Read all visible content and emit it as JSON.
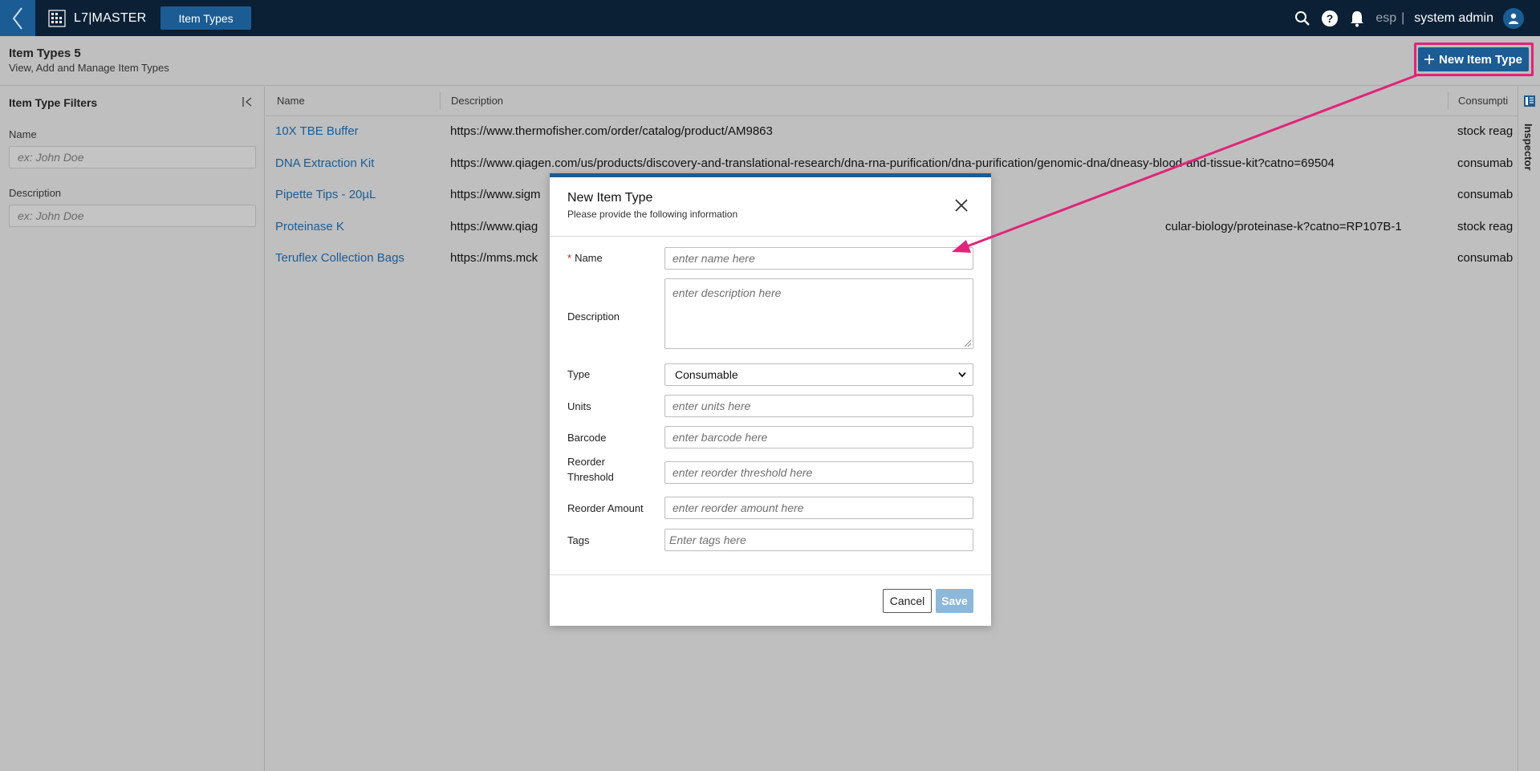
{
  "header": {
    "app_name": "L7|MASTER",
    "nav_tab": "Item Types",
    "language": "esp",
    "separator": "|",
    "user_name": "system admin"
  },
  "page": {
    "title": "Item Types 5",
    "subtitle": "View, Add and Manage Item Types",
    "new_button_label": "New Item Type"
  },
  "filters": {
    "title": "Item Type Filters",
    "name_label": "Name",
    "name_placeholder": "ex: John Doe",
    "description_label": "Description",
    "description_placeholder": "ex: John Doe"
  },
  "table": {
    "columns": [
      "Name",
      "Description",
      "Consumpti"
    ],
    "rows": [
      {
        "name": "10X TBE Buffer",
        "description": "https://www.thermofisher.com/order/catalog/product/AM9863",
        "consumption": "stock reag"
      },
      {
        "name": "DNA Extraction Kit",
        "description": "https://www.qiagen.com/us/products/discovery-and-translational-research/dna-rna-purification/dna-purification/genomic-dna/dneasy-blood-and-tissue-kit?catno=69504",
        "consumption": "consumab"
      },
      {
        "name": "Pipette Tips - 20µL",
        "description": "https://www.sigm",
        "consumption": "consumab"
      },
      {
        "name": "Proteinase K",
        "description": "https://www.qiag",
        "description_tail": "cular-biology/proteinase-k?catno=RP107B-1",
        "consumption": "stock reag"
      },
      {
        "name": "Teruflex Collection Bags",
        "description": "https://mms.mck",
        "consumption": "consumab"
      }
    ]
  },
  "inspector": {
    "label": "Inspector"
  },
  "modal": {
    "title": "New Item Type",
    "subtitle": "Please provide the following information",
    "required_marker": "*",
    "fields": {
      "name": {
        "label": "Name",
        "placeholder": "enter name here"
      },
      "description": {
        "label": "Description",
        "placeholder": "enter description here"
      },
      "type": {
        "label": "Type",
        "value": "Consumable"
      },
      "units": {
        "label": "Units",
        "placeholder": "enter units here"
      },
      "barcode": {
        "label": "Barcode",
        "placeholder": "enter barcode here"
      },
      "reorder_threshold": {
        "label": "Reorder Threshold",
        "placeholder": "enter reorder threshold here"
      },
      "reorder_amount": {
        "label": "Reorder Amount",
        "placeholder": "enter reorder amount here"
      },
      "tags": {
        "label": "Tags",
        "placeholder": "Enter tags here"
      }
    },
    "cancel_label": "Cancel",
    "save_label": "Save"
  },
  "colors": {
    "topbar": "#0b2035",
    "accent": "#1b5c94",
    "highlight": "#e0247a",
    "save_disabled": "#8db8da"
  },
  "icons": [
    "back-chevron-icon",
    "app-grid-icon",
    "search-icon",
    "help-icon",
    "bell-icon",
    "user-icon",
    "plus-icon",
    "collapse-icon",
    "inspector-icon",
    "close-icon",
    "chevron-down-icon"
  ]
}
